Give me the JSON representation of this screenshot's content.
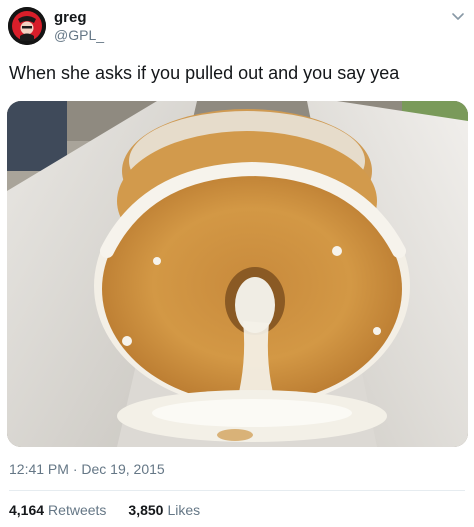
{
  "author": {
    "display_name": "greg",
    "handle": "@GPL_",
    "avatar_icon": "red-profile-avatar"
  },
  "menu": {
    "icon": "chevron-down-icon"
  },
  "tweet": {
    "text": "When she asks if you pulled out and you say yea"
  },
  "media": {
    "kind": "photo",
    "subject": "glazed-donut-in-box"
  },
  "meta": {
    "time": "12:41 PM",
    "separator": "·",
    "date": "Dec 19, 2015"
  },
  "stats": {
    "retweets_count": "4,164",
    "retweets_label": "Retweets",
    "likes_count": "3,850",
    "likes_label": "Likes"
  },
  "colors": {
    "text": "#14171a",
    "secondary": "#657786",
    "divider": "#e6ecf0",
    "avatar_red": "#d81e2a"
  }
}
